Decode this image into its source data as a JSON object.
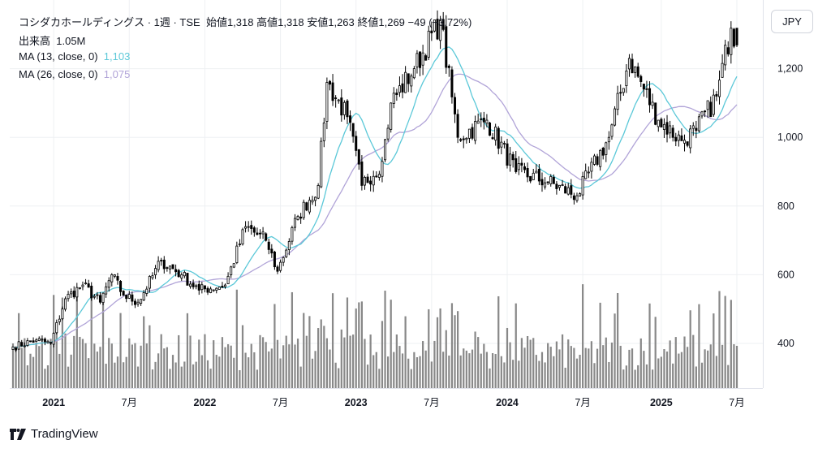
{
  "header": {
    "title": "コシダカホールディングス · 1週 · TSE",
    "ohlc_text": "始値1,318  高値1,318  安値1,263  終値1,269  −49 (−3.72%)",
    "volume_label": "出来高",
    "volume_value": "1.05M",
    "ma13_label": "MA (13, close, 0)",
    "ma13_value": "1,103",
    "ma26_label": "MA (26, close, 0)",
    "ma26_value": "1,075"
  },
  "currency_button": "JPY",
  "brand": "TradingView",
  "colors": {
    "up": "#ffffff",
    "down": "#000000",
    "volume": "#888888",
    "ma13": "#5bc8d8",
    "ma26": "#b1a4d8",
    "grid": "#eef0f3"
  },
  "chart_data": {
    "type": "candlestick",
    "y_ticks": [
      400,
      600,
      800,
      1000,
      1200
    ],
    "y_tick_labels": [
      "400",
      "600",
      "800",
      "1,000",
      "1,200"
    ],
    "x_tick_labels": [
      "2021",
      "7月",
      "2022",
      "7月",
      "2023",
      "7月",
      "2024",
      "7月",
      "2025",
      "7月"
    ],
    "ylim": [
      270,
      1400
    ],
    "start_date": "2020-09-28",
    "weekly_close_anchors": [
      [
        "2020-09-28",
        390
      ],
      [
        "2020-11-23",
        410
      ],
      [
        "2020-12-28",
        400
      ],
      [
        "2021-02-01",
        530
      ],
      [
        "2021-03-15",
        570
      ],
      [
        "2021-04-26",
        520
      ],
      [
        "2021-05-24",
        600
      ],
      [
        "2021-06-21",
        540
      ],
      [
        "2021-07-26",
        520
      ],
      [
        "2021-09-20",
        640
      ],
      [
        "2021-11-08",
        600
      ],
      [
        "2021-12-20",
        555
      ],
      [
        "2022-02-21",
        570
      ],
      [
        "2022-04-11",
        740
      ],
      [
        "2022-05-30",
        700
      ],
      [
        "2022-06-27",
        610
      ],
      [
        "2022-08-15",
        770
      ],
      [
        "2022-10-03",
        860
      ],
      [
        "2022-10-24",
        1160
      ],
      [
        "2022-12-12",
        1060
      ],
      [
        "2023-01-16",
        860
      ],
      [
        "2023-03-06",
        930
      ],
      [
        "2023-03-27",
        1100
      ],
      [
        "2023-05-22",
        1200
      ],
      [
        "2023-07-24",
        1340
      ],
      [
        "2023-09-04",
        1000
      ],
      [
        "2023-11-13",
        1050
      ],
      [
        "2024-01-22",
        900
      ],
      [
        "2024-04-08",
        870
      ],
      [
        "2024-06-17",
        830
      ],
      [
        "2024-09-02",
        1000
      ],
      [
        "2024-10-21",
        1230
      ],
      [
        "2024-12-30",
        1050
      ],
      [
        "2025-02-24",
        990
      ],
      [
        "2025-03-31",
        1020
      ],
      [
        "2025-05-19",
        1120
      ],
      [
        "2025-06-23",
        1318
      ],
      [
        "2025-07-07",
        1269
      ]
    ],
    "last_bar": {
      "open": 1318,
      "high": 1318,
      "low": 1263,
      "close": 1269,
      "change": -49,
      "change_pct": -3.72
    },
    "volume": {
      "label": "出来高",
      "last": "1.05M"
    },
    "ma": [
      {
        "name": "MA (13, close, 0)",
        "last": 1103
      },
      {
        "name": "MA (26, close, 0)",
        "last": 1075
      }
    ]
  }
}
